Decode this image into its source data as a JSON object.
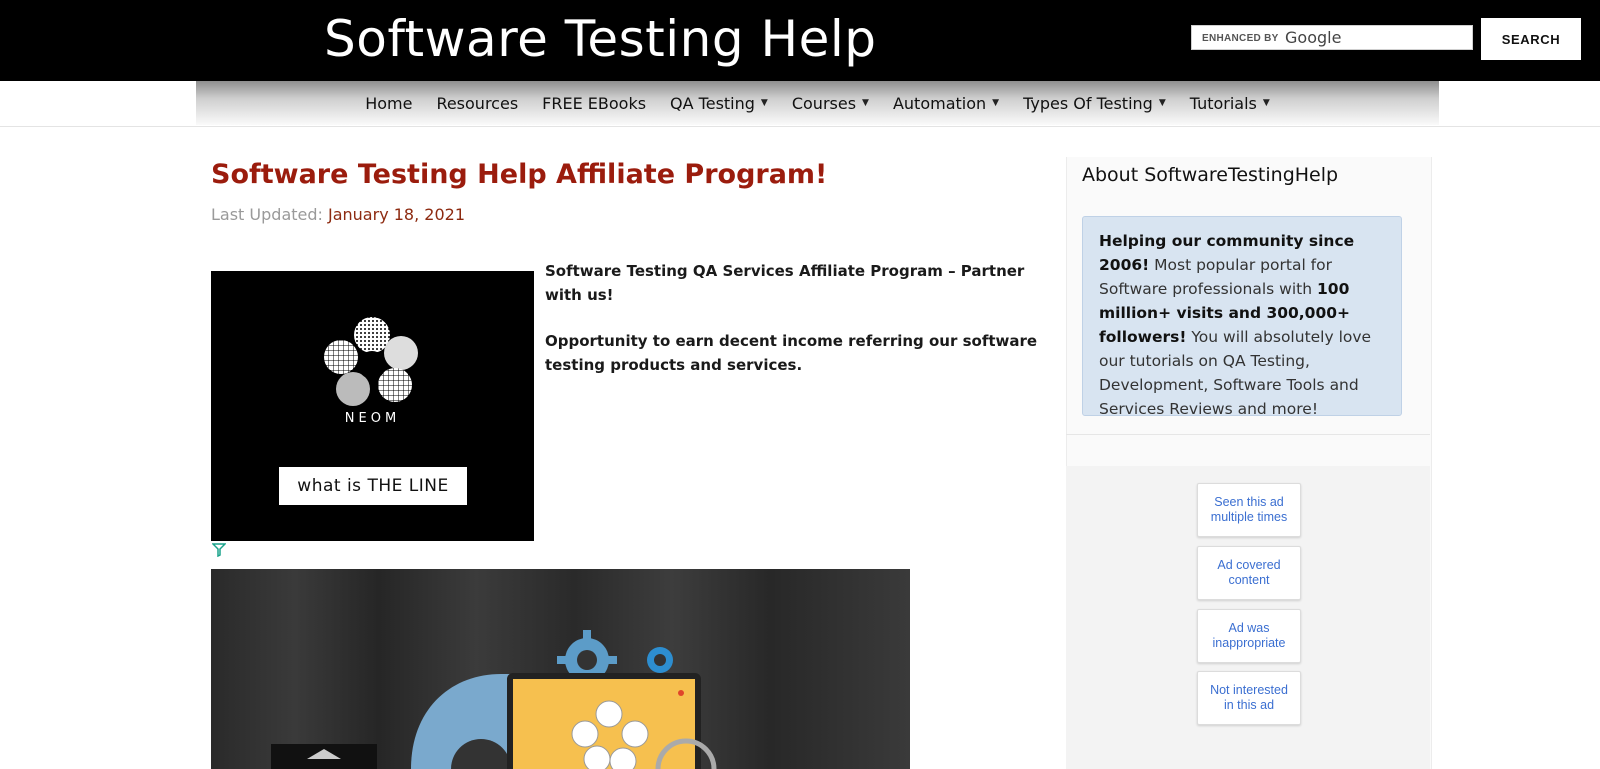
{
  "header": {
    "site_title": "Software Testing Help",
    "search_enhanced_label": "ENHANCED BY",
    "search_provider": "Google",
    "search_button": "SEARCH"
  },
  "nav": {
    "items": [
      {
        "label": "Home",
        "dropdown": false
      },
      {
        "label": "Resources",
        "dropdown": false
      },
      {
        "label": "FREE EBooks",
        "dropdown": false
      },
      {
        "label": "QA Testing",
        "dropdown": true
      },
      {
        "label": "Courses",
        "dropdown": true
      },
      {
        "label": "Automation",
        "dropdown": true
      },
      {
        "label": "Types Of Testing",
        "dropdown": true
      },
      {
        "label": "Tutorials",
        "dropdown": true
      }
    ]
  },
  "post": {
    "title": "Software Testing Help Affiliate Program!",
    "updated_label": "Last Updated:",
    "updated_date": "January 18, 2021",
    "intro_1": "Software Testing QA Services Affiliate Program – Partner with us!",
    "intro_2": "Opportunity to earn decent income referring our software testing products and services."
  },
  "ad": {
    "brand": "NEOM",
    "cta": "what is THE LINE"
  },
  "sidebar": {
    "title": "About SoftwareTestingHelp",
    "about_lead": "Helping our community since 2006!",
    "about_text_1": "Most popular portal for Software professionals with",
    "about_bold": "100 million+ visits and 300,000+ followers!",
    "about_text_2": "You will absolutely love our tutorials on QA Testing, Development, Software Tools and Services Reviews and more!",
    "ad_feedback": [
      "Seen this ad multiple times",
      "Ad covered content",
      "Ad was inappropriate",
      "Not interested in this ad"
    ]
  },
  "colors": {
    "title_red": "#9b1c0d",
    "date_brown": "#8d2a10",
    "about_bg": "#d8e4f1",
    "feedback_blue": "#3b6fd1"
  }
}
